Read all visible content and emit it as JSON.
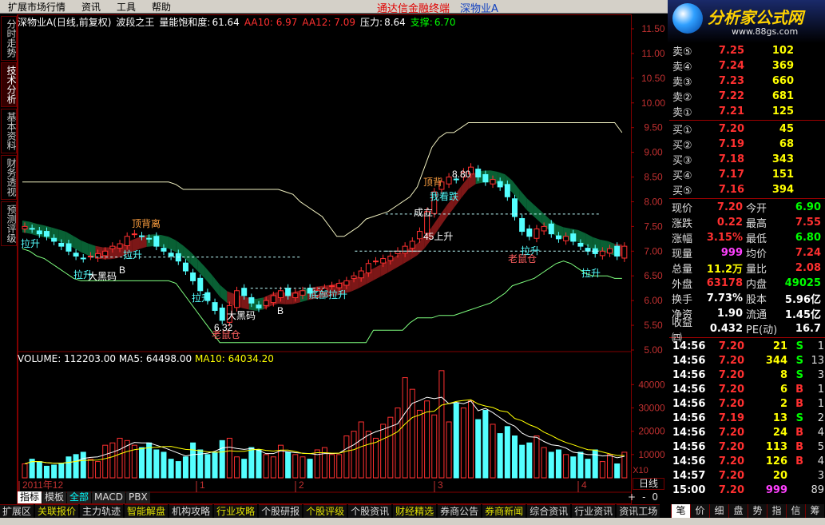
{
  "menu": {
    "items": [
      "扩展市场行情",
      "资讯",
      "工具",
      "帮助"
    ],
    "title_red": "通达信金融终端",
    "title_blue": "深物业A"
  },
  "logo": {
    "text": "分析家公式网",
    "url": "www.88gs.com"
  },
  "side_tabs": [
    "分时走势",
    "技术分析",
    "基本资料",
    "财务透视",
    "预测评级"
  ],
  "info": {
    "name": "深物业A(日线,前复权)",
    "indicator": "波段之王",
    "saturation_label": "量能饱和度:",
    "saturation_value": "61.64",
    "aa10": "AA10: 6.97",
    "aa12": "AA12: 7.09",
    "pressure_label": "压力:",
    "pressure_value": "8.64",
    "support_label": "支撑:",
    "support_value": "6.70"
  },
  "vol_info": {
    "volume": "VOLUME: 112203.00",
    "ma5": "MA5: 64498.00",
    "ma10": "MA10: 64034.20"
  },
  "price_axis": [
    "11.50",
    "11.00",
    "10.50",
    "10.00",
    "9.50",
    "9.00",
    "8.50",
    "8.00",
    "7.50",
    "7.00",
    "6.50",
    "6.00",
    "5.50",
    "5.00"
  ],
  "vol_axis": [
    "40000",
    "30000",
    "20000",
    "10000"
  ],
  "vol_unit": "X10",
  "date_axis": [
    {
      "t": "2011年12"
    },
    {
      "t": "1"
    },
    {
      "t": "2"
    },
    {
      "t": "3"
    },
    {
      "t": "4"
    }
  ],
  "annotations": {
    "ding_bei_li": "顶背离",
    "la_sheng": "拉升",
    "da_hei_ma": "大黑码",
    "lao_shu_cang": "老鼠仓",
    "b": "B",
    "di_bu_fang_sheng": "底部拉升",
    "sheng_45": "45上升",
    "cheng_li": "成立",
    "low_label": "6.32",
    "high_label": "8.80",
    "ding_bei": "顶背",
    "kan_shang_die": "我看跌"
  },
  "chart_data": {
    "type": "candlestick",
    "ylim": [
      5.0,
      11.5
    ],
    "closes": [
      7.5,
      7.45,
      7.35,
      7.3,
      7.2,
      7.1,
      7.0,
      6.9,
      6.85,
      6.9,
      6.95,
      7.0,
      7.1,
      7.15,
      7.3,
      7.35,
      7.3,
      7.25,
      7.1,
      7.0,
      6.9,
      6.8,
      6.6,
      6.4,
      6.2,
      6.0,
      5.8,
      5.6,
      5.9,
      6.2,
      6.1,
      5.95,
      5.85,
      6.0,
      6.1,
      6.2,
      6.1,
      6.15,
      6.2,
      6.15,
      6.2,
      6.25,
      6.3,
      6.35,
      6.4,
      6.5,
      6.6,
      6.75,
      6.8,
      6.85,
      6.9,
      7.0,
      7.1,
      7.2,
      7.4,
      7.8,
      8.2,
      8.4,
      8.5,
      8.45,
      8.6,
      8.7,
      8.5,
      8.4,
      8.45,
      8.3,
      8.1,
      7.7,
      7.4,
      7.3,
      7.45,
      7.5,
      7.35,
      7.25,
      7.3,
      7.2,
      7.1,
      7.0,
      6.95,
      7.0,
      7.05,
      6.9,
      7.1
    ],
    "volumes": [
      600,
      800,
      700,
      500,
      550,
      600,
      900,
      1000,
      1100,
      800,
      700,
      1400,
      1500,
      1700,
      1600,
      1400,
      1300,
      1500,
      1200,
      1100,
      800,
      700,
      900,
      1500,
      1200,
      1000,
      1100,
      1600,
      1700,
      900,
      800,
      1300,
      1200,
      1000,
      900,
      1400,
      1100,
      1000,
      900,
      800,
      1200,
      1300,
      1000,
      1000,
      1800,
      2000,
      2400,
      2000,
      1700,
      2300,
      2600,
      3000,
      4300,
      3800,
      2900,
      3300,
      2700,
      4600,
      2400,
      3200,
      3000,
      3300,
      2500,
      2900,
      2300,
      1900,
      2200,
      1800,
      1400,
      1500,
      1800,
      1300,
      1100,
      1200,
      1000,
      900,
      1100,
      800,
      1200,
      700,
      1000,
      600,
      1100
    ]
  },
  "order_book": [
    {
      "label": "卖⑤",
      "price": "7.25",
      "vol": "102"
    },
    {
      "label": "卖④",
      "price": "7.24",
      "vol": "369"
    },
    {
      "label": "卖③",
      "price": "7.23",
      "vol": "660"
    },
    {
      "label": "卖②",
      "price": "7.22",
      "vol": "681"
    },
    {
      "label": "卖①",
      "price": "7.21",
      "vol": "125"
    },
    {
      "label": "买①",
      "price": "7.20",
      "vol": "45"
    },
    {
      "label": "买②",
      "price": "7.19",
      "vol": "68"
    },
    {
      "label": "买③",
      "price": "7.18",
      "vol": "343"
    },
    {
      "label": "买④",
      "price": "7.17",
      "vol": "151"
    },
    {
      "label": "买⑤",
      "price": "7.16",
      "vol": "394"
    }
  ],
  "quote": [
    {
      "k": "现价",
      "v": "7.20",
      "vc": "red",
      "k2": "今开",
      "v2": "6.90",
      "v2c": "green"
    },
    {
      "k": "涨跌",
      "v": "0.22",
      "vc": "red",
      "k2": "最高",
      "v2": "7.55",
      "v2c": "red"
    },
    {
      "k": "涨幅",
      "v": "3.15%",
      "vc": "red",
      "k2": "最低",
      "v2": "6.80",
      "v2c": "green"
    },
    {
      "k": "现量",
      "v": "999",
      "vc": "mag",
      "k2": "均价",
      "v2": "7.24",
      "v2c": "red"
    },
    {
      "k": "总量",
      "v": "11.2万",
      "vc": "yel",
      "k2": "量比",
      "v2": "2.08",
      "v2c": "red"
    },
    {
      "k": "外盘",
      "v": "63178",
      "vc": "red",
      "k2": "内盘",
      "v2": "49025",
      "v2c": "green"
    },
    {
      "k": "换手",
      "v": "7.73%",
      "vc": "white",
      "k2": "股本",
      "v2": "5.96亿",
      "v2c": "white"
    },
    {
      "k": "净资",
      "v": "1.90",
      "vc": "white",
      "k2": "流通",
      "v2": "1.45亿",
      "v2c": "white"
    },
    {
      "k": "收益㈣",
      "v": "0.432",
      "vc": "white",
      "k2": "PE(动)",
      "v2": "16.7",
      "v2c": "white"
    }
  ],
  "ticks": [
    {
      "t": "14:56",
      "p": "7.20",
      "v": "21",
      "bs": "S",
      "n": "1"
    },
    {
      "t": "14:56",
      "p": "7.20",
      "v": "344",
      "bs": "S",
      "n": "13"
    },
    {
      "t": "14:56",
      "p": "7.20",
      "v": "8",
      "bs": "S",
      "n": "3"
    },
    {
      "t": "14:56",
      "p": "7.20",
      "v": "6",
      "bs": "B",
      "n": "1"
    },
    {
      "t": "14:56",
      "p": "7.20",
      "v": "2",
      "bs": "B",
      "n": "1"
    },
    {
      "t": "14:56",
      "p": "7.19",
      "v": "13",
      "bs": "S",
      "n": "2"
    },
    {
      "t": "14:56",
      "p": "7.20",
      "v": "24",
      "bs": "B",
      "n": "4"
    },
    {
      "t": "14:56",
      "p": "7.20",
      "v": "113",
      "bs": "B",
      "n": "5"
    },
    {
      "t": "14:56",
      "p": "7.20",
      "v": "126",
      "bs": "B",
      "n": "4"
    },
    {
      "t": "14:57",
      "p": "7.20",
      "v": "20",
      "bs": "",
      "n": "3"
    },
    {
      "t": "15:00",
      "p": "7.20",
      "v": "999",
      "bs": "",
      "n": "89"
    }
  ],
  "sub_tabs": [
    "指标",
    "模板",
    "全部",
    "MACD",
    "PBX"
  ],
  "pager": [
    "+",
    "-",
    "0"
  ],
  "day_button": "日线",
  "bottom_tabs": [
    "扩展区",
    "关联报价",
    "主力轨迹",
    "智能解盘",
    "机构攻略",
    "行业攻略",
    "个股研报",
    "个股评级",
    "个股资讯",
    "财经精选",
    "券商公告",
    "券商新闻",
    "综合资讯",
    "行业资讯",
    "资讯工场"
  ],
  "right_tabs": [
    "笔",
    "价",
    "细",
    "盘",
    "势",
    "指",
    "信",
    "筹"
  ],
  "colors": {
    "up": "#ff3030",
    "down": "#54ffff",
    "ma_green": "#0a6a3a",
    "ma_red": "#8a1a1a",
    "grid": "#800000"
  }
}
